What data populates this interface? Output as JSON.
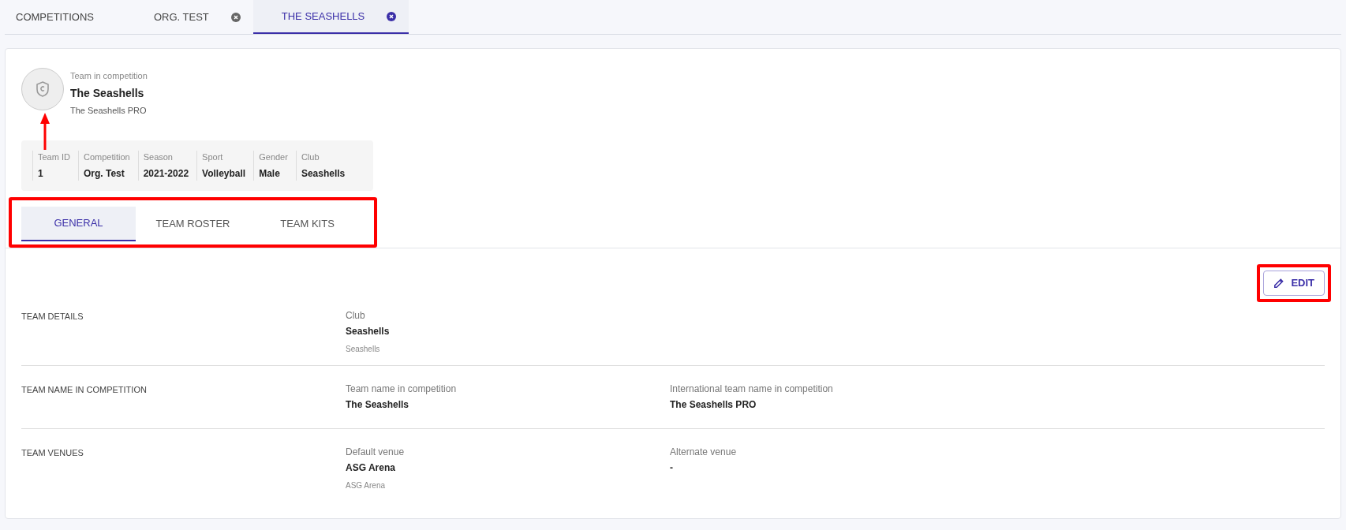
{
  "top_tabs": [
    {
      "label": "COMPETITIONS",
      "closable": false,
      "selected": false
    },
    {
      "label": "ORG. TEST",
      "closable": true,
      "selected": false
    },
    {
      "label": "THE SEASHELLS",
      "closable": true,
      "selected": true
    }
  ],
  "header": {
    "caption": "Team in competition",
    "title": "The Seashells",
    "subtitle": "The Seashells PRO"
  },
  "facts": [
    {
      "label": "Team ID",
      "value": "1"
    },
    {
      "label": "Competition",
      "value": "Org. Test"
    },
    {
      "label": "Season",
      "value": "2021-2022"
    },
    {
      "label": "Sport",
      "value": "Volleyball"
    },
    {
      "label": "Gender",
      "value": "Male"
    },
    {
      "label": "Club",
      "value": "Seashells"
    }
  ],
  "tabs": [
    {
      "label": "GENERAL",
      "selected": true
    },
    {
      "label": "TEAM ROSTER",
      "selected": false
    },
    {
      "label": "TEAM KITS",
      "selected": false
    }
  ],
  "edit_button": "EDIT",
  "sections": [
    {
      "title": "TEAM DETAILS",
      "fields": [
        {
          "label": "Club",
          "value": "Seashells",
          "note": "Seashells"
        }
      ]
    },
    {
      "title": "TEAM NAME IN COMPETITION",
      "fields": [
        {
          "label": "Team name in competition",
          "value": "The Seashells"
        },
        {
          "label": "International team name in competition",
          "value": "The Seashells PRO"
        }
      ]
    },
    {
      "title": "TEAM VENUES",
      "fields": [
        {
          "label": "Default venue",
          "value": "ASG Arena",
          "note": "ASG Arena"
        },
        {
          "label": "Alternate venue",
          "value": "-"
        }
      ]
    }
  ]
}
